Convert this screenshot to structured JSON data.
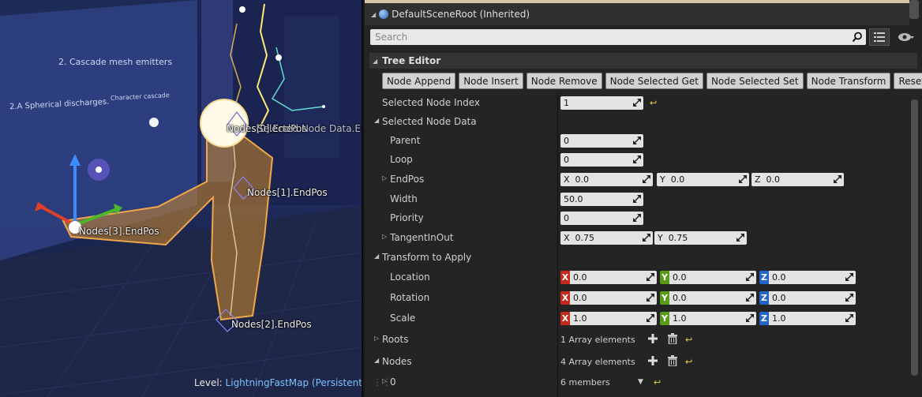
{
  "viewport": {
    "wall_texts": {
      "cascade": "2. Cascade mesh emitters",
      "spherical": "2.A Spherical discharges.",
      "character": "Character cascade"
    },
    "node_labels": {
      "node0": "Nodes[0].EndPos",
      "node0_overlap": "Selected Node Data.EndPos",
      "node1": "Nodes[1].EndPos",
      "node2": "Nodes[2].EndPos",
      "node3": "Nodes[3].EndPos"
    },
    "level_prefix": "Level:",
    "level_name": "LightningFastMap (Persistent)"
  },
  "details": {
    "scene_root_label": "DefaultSceneRoot (Inherited)",
    "search_placeholder": "Search",
    "category_title": "Tree Editor",
    "buttons": {
      "append": "Node Append",
      "insert": "Node Insert",
      "remove": "Node Remove",
      "selected_get": "Node Selected Get",
      "selected_set": "Node Selected Set",
      "transform": "Node Transform",
      "reset": "Reset"
    },
    "selected_node_index": {
      "label": "Selected Node Index",
      "value": "1"
    },
    "selected_node_data": {
      "label": "Selected Node Data",
      "parent": {
        "label": "Parent",
        "value": "0"
      },
      "loop": {
        "label": "Loop",
        "value": "0"
      },
      "endpos": {
        "label": "EndPos",
        "x": "0.0",
        "y": "0.0",
        "z": "0.0"
      },
      "width": {
        "label": "Width",
        "value": "50.0"
      },
      "priority": {
        "label": "Priority",
        "value": "0"
      },
      "tangent": {
        "label": "TangentInOut",
        "x": "0.75",
        "y": "0.75"
      }
    },
    "transform_to_apply": {
      "label": "Transform to Apply",
      "location": {
        "label": "Location",
        "x": "0.0",
        "y": "0.0",
        "z": "0.0"
      },
      "rotation": {
        "label": "Rotation",
        "x": "0.0",
        "y": "0.0",
        "z": "0.0"
      },
      "scale": {
        "label": "Scale",
        "x": "1.0",
        "y": "1.0",
        "z": "1.0"
      }
    },
    "axis_letters": {
      "x": "X",
      "y": "Y",
      "z": "Z"
    },
    "roots": {
      "label": "Roots",
      "value": "1 Array elements"
    },
    "nodes": {
      "label": "Nodes",
      "value": "4 Array elements"
    },
    "node0": {
      "label": "0",
      "value": "6 members"
    }
  },
  "colors": {
    "axis_x": "#c42b1c",
    "axis_y": "#5a9a1a",
    "axis_z": "#2463c8",
    "reset_arrow": "#e8d63a",
    "selection_orange": "#e8a23a"
  }
}
